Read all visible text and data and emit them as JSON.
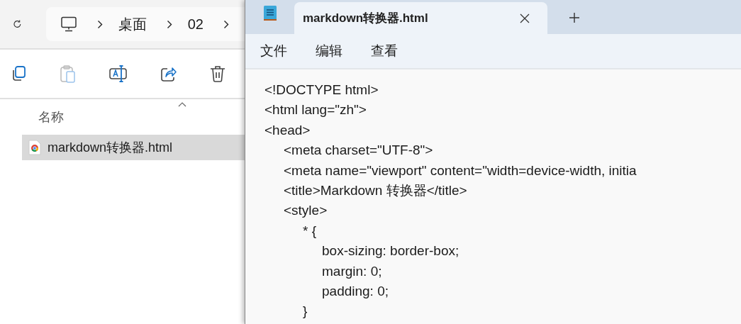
{
  "explorer": {
    "breadcrumb": [
      "桌面",
      "02"
    ],
    "column_header": "名称",
    "files": [
      {
        "name": "markdown转换器.html",
        "selected": true
      }
    ]
  },
  "notepad": {
    "tabs": [
      {
        "title": "markdown转换器.html",
        "selected": true
      }
    ],
    "menu": [
      "文件",
      "编辑",
      "查看"
    ],
    "lines": [
      "<!DOCTYPE html>",
      "<html lang=\"zh\">",
      "<head>",
      "\t<meta charset=\"UTF-8\">",
      "\t<meta name=\"viewport\" content=\"width=device-width, initia",
      "\t<title>Markdown 转换器</title>",
      "\t<style>",
      "\t\t* {",
      "\t\t\tbox-sizing: border-box;",
      "\t\t\tmargin: 0;",
      "\t\t\tpadding: 0;",
      "\t\t}"
    ]
  }
}
